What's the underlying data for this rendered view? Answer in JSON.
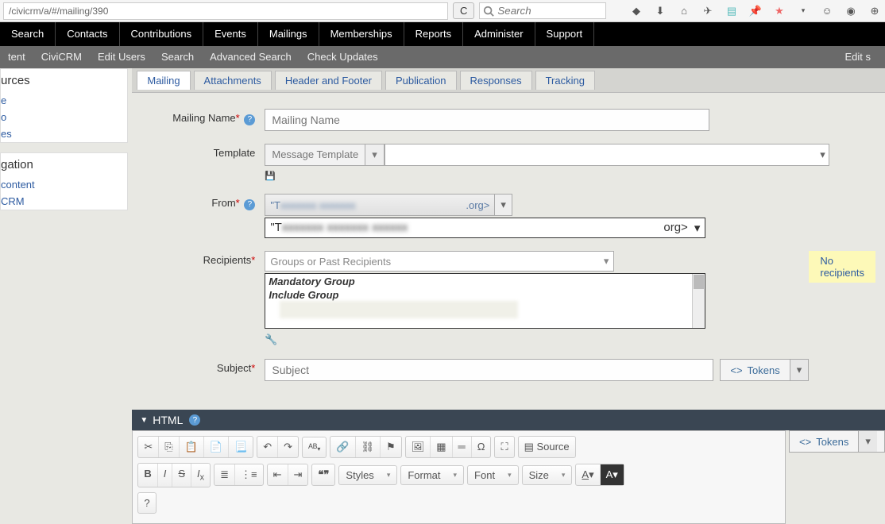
{
  "browser": {
    "url": "/civicrm/a/#/mailing/390",
    "search_placeholder": "Search"
  },
  "nav_main": [
    "Search",
    "Contacts",
    "Contributions",
    "Events",
    "Mailings",
    "Memberships",
    "Reports",
    "Administer",
    "Support"
  ],
  "nav_sub_left": [
    "tent",
    "CiviCRM",
    "Edit Users",
    "Search",
    "Advanced Search",
    "Check Updates"
  ],
  "nav_sub_right": "Edit s",
  "sidebar": {
    "block1_title": "urces",
    "block1_items": [
      "e",
      "o",
      "es"
    ],
    "block2_title": "gation",
    "block2_items": [
      " content",
      "CRM"
    ]
  },
  "tabs": [
    "Mailing",
    "Attachments",
    "Header and Footer",
    "Publication",
    "Responses",
    "Tracking"
  ],
  "form": {
    "mailing_name": {
      "label": "Mailing Name",
      "placeholder": "Mailing Name"
    },
    "template": {
      "label": "Template",
      "placeholder": "Message Template"
    },
    "from": {
      "label": "From",
      "prefix": "\"T",
      "suffix": ".org>",
      "full_prefix": "\"T",
      "full_suffix": "org>"
    },
    "recipients": {
      "label": "Recipients",
      "placeholder": "Groups or Past Recipients",
      "mandatory": "Mandatory Group",
      "include": "Include Group",
      "badge": "No recipients"
    },
    "subject": {
      "label": "Subject",
      "placeholder": "Subject"
    },
    "tokens": "Tokens"
  },
  "editor": {
    "title": "HTML",
    "source": "Source",
    "styles": "Styles",
    "format": "Format",
    "font": "Font",
    "size": "Size",
    "help": "?"
  }
}
